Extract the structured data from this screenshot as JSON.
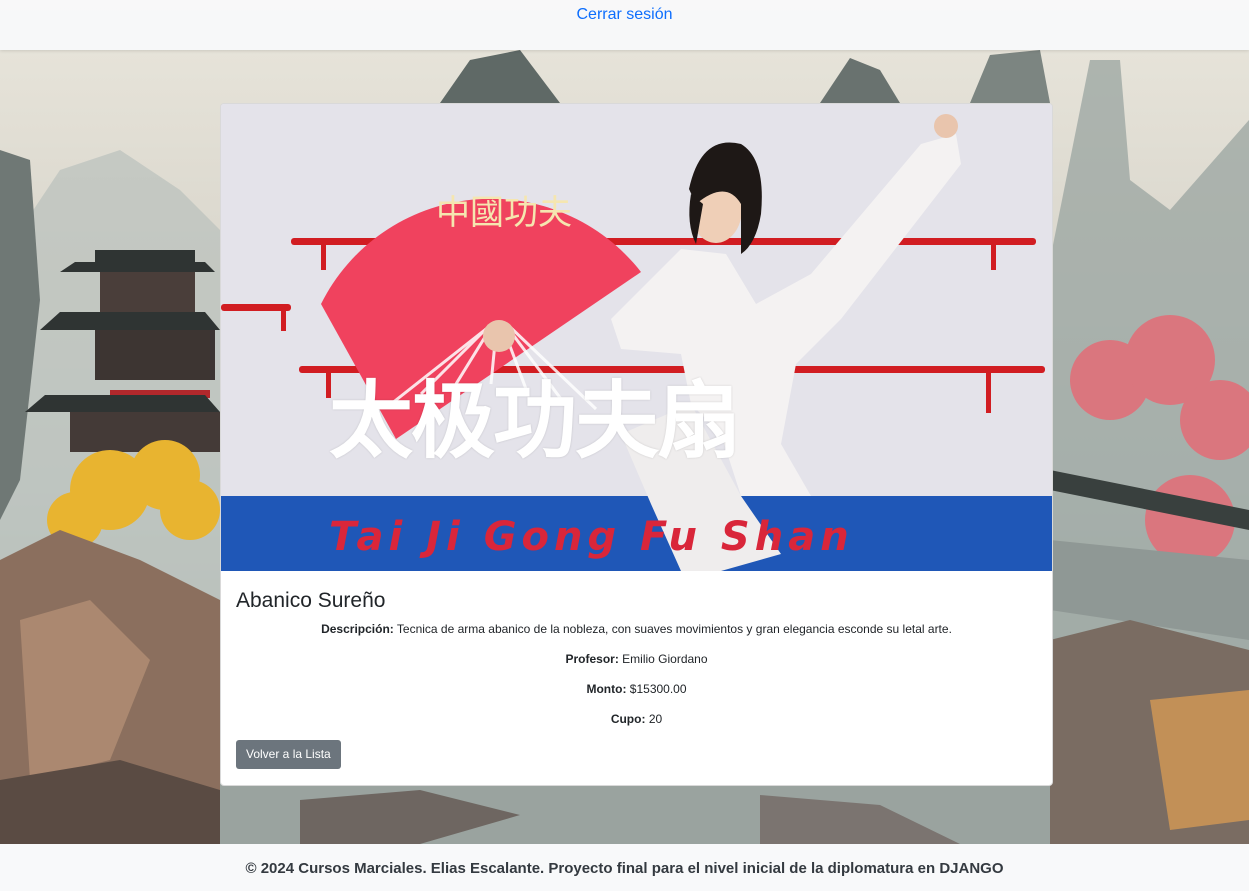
{
  "topbar": {
    "logout_label": "Cerrar sesión"
  },
  "course": {
    "image_title": "太极功夫扇",
    "image_subtitle": "Tai Ji Gong Fu Shan",
    "fan_text": "中國功夫",
    "title": "Abanico Sureño",
    "description_label": "Descripción:",
    "description": "Tecnica de arma abanico de la nobleza, con suaves movimientos y gran elegancia esconde su letal arte.",
    "teacher_label": "Profesor:",
    "teacher": "Emilio Giordano",
    "price_label": "Monto:",
    "price": "$15300.00",
    "quota_label": "Cupo:",
    "quota": "20",
    "back_label": "Volver a la Lista"
  },
  "footer": {
    "text": "© 2024 Cursos Marciales. Elias Escalante. Proyecto final para el nivel inicial de la diplomatura en DJANGO"
  },
  "colors": {
    "link": "#0d6efd",
    "button_secondary": "#6c757d",
    "fan_red": "#f0425e",
    "subtitle_red": "#d9263a"
  },
  "icons": {
    "background": "chinese-landscape-painting"
  }
}
